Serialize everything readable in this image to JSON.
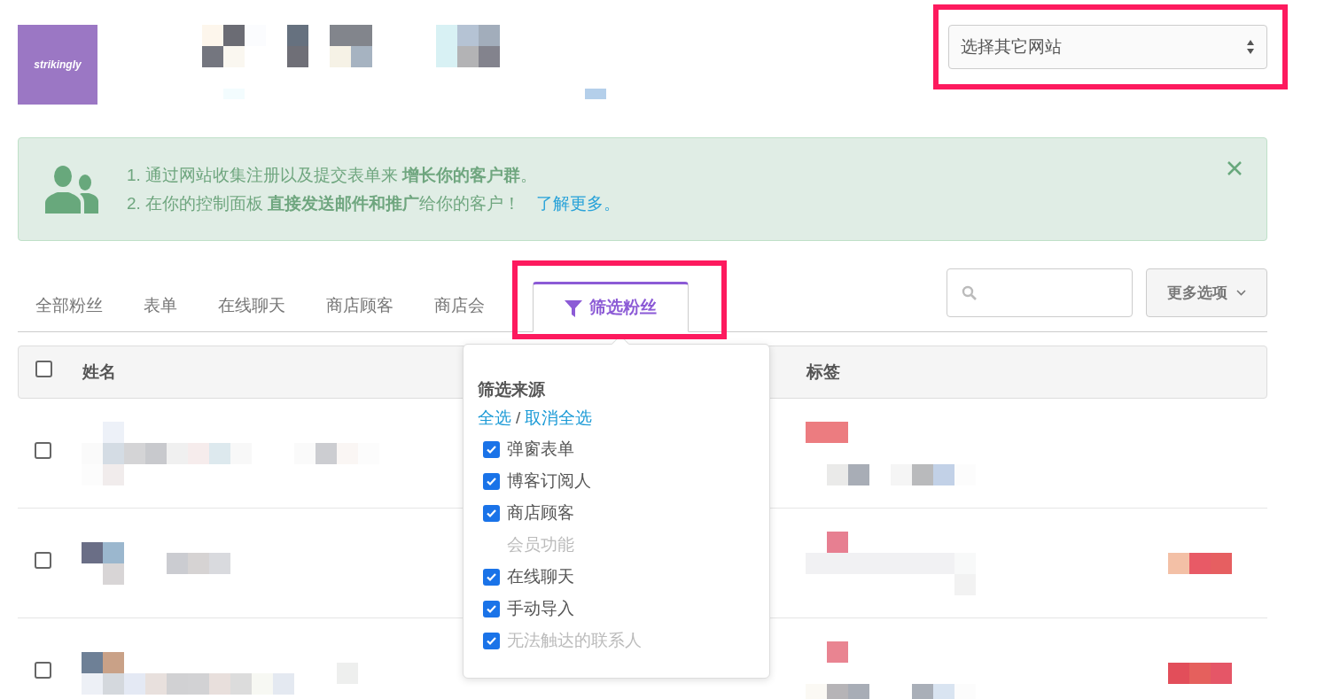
{
  "logo": {
    "text": "strikingly"
  },
  "site_selector": {
    "value": "选择其它网站"
  },
  "notice": {
    "lines": [
      "1. 通过网站收集注册以及提交表单来 **增长你的客户群**。",
      "2. 在你的控制面板 **直接发送邮件和推广**给你的客户！"
    ],
    "link": "了解更多。"
  },
  "tabs": [
    {
      "label": "全部粉丝",
      "selected": false
    },
    {
      "label": "表单",
      "selected": false
    },
    {
      "label": "在线聊天",
      "selected": false
    },
    {
      "label": "商店顾客",
      "selected": false
    },
    {
      "label": "商店会",
      "selected": false
    },
    {
      "label": "筛选粉丝",
      "selected": true
    }
  ],
  "more_button": {
    "label": "更多选项"
  },
  "table": {
    "select_all_checked": false,
    "columns": [
      "姓名",
      "标签"
    ],
    "rows": [
      {
        "checked": false
      },
      {
        "checked": false
      },
      {
        "checked": false
      }
    ]
  },
  "filter_popover": {
    "title": "筛选来源",
    "select_all": "全选",
    "separator": "/",
    "deselect_all": "取消全选",
    "options": [
      {
        "kind": "checkbox",
        "label": "弹窗表单",
        "checked": true,
        "disabled": false
      },
      {
        "kind": "checkbox",
        "label": "博客订阅人",
        "checked": true,
        "disabled": false
      },
      {
        "kind": "checkbox",
        "label": "商店顾客",
        "checked": true,
        "disabled": false
      },
      {
        "kind": "plain",
        "label": "会员功能",
        "disabled": true
      },
      {
        "kind": "checkbox",
        "label": "在线聊天",
        "checked": true,
        "disabled": false
      },
      {
        "kind": "checkbox",
        "label": "手动导入",
        "checked": true,
        "disabled": false
      },
      {
        "kind": "checkbox",
        "label": "无法触达的联系人",
        "checked": true,
        "disabled": true
      }
    ]
  }
}
